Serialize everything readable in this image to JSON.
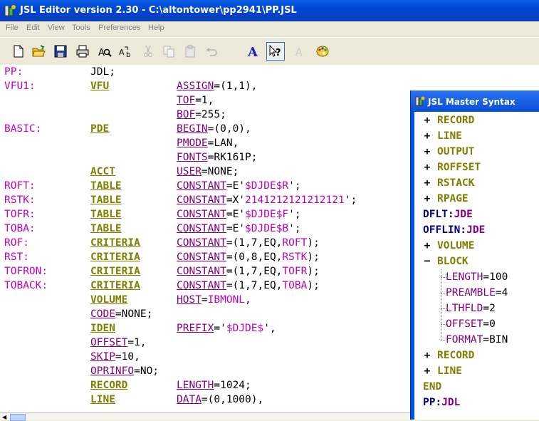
{
  "window": {
    "title": "JSL Editor version 2.30 - C:\\altontower\\pp2941\\PP.JSL"
  },
  "menu": [
    "File",
    "Edit",
    "View",
    "Tools",
    "Preferences",
    "Help"
  ],
  "toolbar": [
    "new-icon",
    "open-icon",
    "save-icon",
    "print-icon",
    "find-icon",
    "replace-icon",
    "cut-icon",
    "copy-icon",
    "paste-icon",
    "undo-icon",
    "font-icon",
    "context-help-icon",
    "font-disabled-icon",
    "palette-icon"
  ],
  "editor": {
    "lines": [
      {
        "c1": "PP:",
        "c2": "JDL;",
        "c2kw": false,
        "c3": []
      },
      {
        "c1": "VFU1:",
        "c2": "VFU",
        "c2kw": true,
        "c3": [
          {
            "t": "ASSIGN",
            "k": "op"
          },
          {
            "t": "=(1,1),",
            "k": "pl"
          }
        ]
      },
      {
        "c1": "",
        "c2": "",
        "c3": [
          {
            "t": "TOF",
            "k": "op"
          },
          {
            "t": "=1,",
            "k": "pl"
          }
        ]
      },
      {
        "c1": "",
        "c2": "",
        "c3": [
          {
            "t": "BOF",
            "k": "op"
          },
          {
            "t": "=255;",
            "k": "pl"
          }
        ]
      },
      {
        "c1": "BASIC:",
        "c2": "PDE",
        "c2kw": true,
        "c3": [
          {
            "t": "BEGIN",
            "k": "op"
          },
          {
            "t": "=(0,0),",
            "k": "pl"
          }
        ]
      },
      {
        "c1": "",
        "c2": "",
        "c3": [
          {
            "t": "PMODE",
            "k": "op"
          },
          {
            "t": "=LAN,",
            "k": "pl"
          }
        ]
      },
      {
        "c1": "",
        "c2": "",
        "c3": [
          {
            "t": "FONTS",
            "k": "op"
          },
          {
            "t": "=RK161P;",
            "k": "pl"
          }
        ]
      },
      {
        "c1": "",
        "c2": "ACCT",
        "c2kw": true,
        "c3": [
          {
            "t": "USER",
            "k": "op"
          },
          {
            "t": "=NONE;",
            "k": "pl"
          }
        ]
      },
      {
        "c1": "ROFT:",
        "c2": "TABLE",
        "c2kw": true,
        "c3": [
          {
            "t": "CONSTANT",
            "k": "op"
          },
          {
            "t": "=E'",
            "k": "pl"
          },
          {
            "t": "$DJDE$R",
            "k": "mg"
          },
          {
            "t": "';",
            "k": "pl"
          }
        ]
      },
      {
        "c1": "RSTK:",
        "c2": "TABLE",
        "c2kw": true,
        "c3": [
          {
            "t": "CONSTANT",
            "k": "op"
          },
          {
            "t": "=X'",
            "k": "pl"
          },
          {
            "t": "2141212121212121",
            "k": "mg"
          },
          {
            "t": "';",
            "k": "pl"
          }
        ]
      },
      {
        "c1": "TOFR:",
        "c2": "TABLE",
        "c2kw": true,
        "c3": [
          {
            "t": "CONSTANT",
            "k": "op"
          },
          {
            "t": "=E'",
            "k": "pl"
          },
          {
            "t": "$DJDE$F",
            "k": "mg"
          },
          {
            "t": "';",
            "k": "pl"
          }
        ]
      },
      {
        "c1": "TOBA:",
        "c2": "TABLE",
        "c2kw": true,
        "c3": [
          {
            "t": "CONSTANT",
            "k": "op"
          },
          {
            "t": "=E'",
            "k": "pl"
          },
          {
            "t": "$DJDE$B",
            "k": "mg"
          },
          {
            "t": "';",
            "k": "pl"
          }
        ]
      },
      {
        "c1": "ROF:",
        "c2": "CRITERIA",
        "c2kw": true,
        "c3": [
          {
            "t": "CONSTANT",
            "k": "op"
          },
          {
            "t": "=(1,7,EQ,",
            "k": "pl"
          },
          {
            "t": "ROFT",
            "k": "mg"
          },
          {
            "t": ");",
            "k": "pl"
          }
        ]
      },
      {
        "c1": "RST:",
        "c2": "CRITERIA",
        "c2kw": true,
        "c3": [
          {
            "t": "CONSTANT",
            "k": "op"
          },
          {
            "t": "=(0,8,EQ,",
            "k": "pl"
          },
          {
            "t": "RSTK",
            "k": "mg"
          },
          {
            "t": ");",
            "k": "pl"
          }
        ]
      },
      {
        "c1": "TOFRON:",
        "c2": "CRITERIA",
        "c2kw": true,
        "c3": [
          {
            "t": "CONSTANT",
            "k": "op"
          },
          {
            "t": "=(1,7,EQ,",
            "k": "pl"
          },
          {
            "t": "TOFR",
            "k": "mg"
          },
          {
            "t": ");",
            "k": "pl"
          }
        ]
      },
      {
        "c1": "TOBACK:",
        "c2": "CRITERIA",
        "c2kw": true,
        "c3": [
          {
            "t": "CONSTANT",
            "k": "op"
          },
          {
            "t": "=(1,7,EQ,",
            "k": "pl"
          },
          {
            "t": "TOBA",
            "k": "mg"
          },
          {
            "t": ");",
            "k": "pl"
          }
        ]
      },
      {
        "c1": "",
        "c2": "VOLUME",
        "c2kw": true,
        "c3": [
          {
            "t": "HOST",
            "k": "op"
          },
          {
            "t": "=",
            "k": "pl"
          },
          {
            "t": "IBMONL",
            "k": "mg"
          },
          {
            "t": ",",
            "k": "pl"
          }
        ]
      },
      {
        "c1": "",
        "c2": "",
        "c2line": [
          {
            "t": "CODE",
            "k": "op"
          },
          {
            "t": "=NONE;",
            "k": "pl"
          }
        ],
        "c3": []
      },
      {
        "c1": "",
        "c2": "IDEN",
        "c2kw": true,
        "c3": [
          {
            "t": "PREFIX",
            "k": "op"
          },
          {
            "t": "='",
            "k": "pl"
          },
          {
            "t": "$DJDE$",
            "k": "mg"
          },
          {
            "t": "',",
            "k": "pl"
          }
        ]
      },
      {
        "c1": "",
        "c2": "",
        "c2line": [
          {
            "t": "OFFSET",
            "k": "op"
          },
          {
            "t": "=1,",
            "k": "pl"
          }
        ],
        "c3": []
      },
      {
        "c1": "",
        "c2": "",
        "c2line": [
          {
            "t": "SKIP",
            "k": "op"
          },
          {
            "t": "=10,",
            "k": "pl"
          }
        ],
        "c3": []
      },
      {
        "c1": "",
        "c2": "",
        "c2line": [
          {
            "t": "OPRINFO",
            "k": "op"
          },
          {
            "t": "=NO;",
            "k": "pl"
          }
        ],
        "c3": []
      },
      {
        "c1": "",
        "c2": "RECORD",
        "c2kw": true,
        "c3": [
          {
            "t": "LENGTH",
            "k": "op"
          },
          {
            "t": "=1024;",
            "k": "pl"
          }
        ]
      },
      {
        "c1": "",
        "c2": "LINE",
        "c2kw": true,
        "c3": [
          {
            "t": "DATA",
            "k": "op"
          },
          {
            "t": "=(0,1000),",
            "k": "pl"
          }
        ]
      }
    ]
  },
  "master_syntax": {
    "title": "JSL Master Syntax",
    "nodes": [
      {
        "pm": "+",
        "label": "RECORD",
        "kind": "kw"
      },
      {
        "pm": "+",
        "label": "LINE",
        "kind": "kw"
      },
      {
        "pm": "+",
        "label": "OUTPUT",
        "kind": "kw"
      },
      {
        "pm": "+",
        "label": "ROFFSET",
        "kind": "kw"
      },
      {
        "pm": "+",
        "label": "RSTACK",
        "kind": "kw"
      },
      {
        "pm": "+",
        "label": "RPAGE",
        "kind": "kw"
      },
      {
        "pm": "",
        "label": "DFLT",
        "sep": ":",
        "val": "JDE",
        "kind": "blue"
      },
      {
        "pm": "",
        "label": "OFFLIN",
        "sep": ":",
        "val": "JDE",
        "kind": "blue"
      },
      {
        "pm": "+",
        "label": "VOLUME",
        "kind": "kw"
      },
      {
        "pm": "−",
        "label": "BLOCK",
        "kind": "kw"
      },
      {
        "pm": "",
        "label": "LENGTH",
        "sep": "=",
        "val": "100",
        "kind": "leaf"
      },
      {
        "pm": "",
        "label": "PREAMBLE",
        "sep": "=",
        "val": "4",
        "kind": "leaf"
      },
      {
        "pm": "",
        "label": "LTHFLD",
        "sep": "=",
        "val": "2",
        "kind": "leaf"
      },
      {
        "pm": "",
        "label": "OFFSET",
        "sep": "=",
        "val": "0",
        "kind": "leaf"
      },
      {
        "pm": "",
        "label": "FORMAT",
        "sep": "=",
        "val": "BIN",
        "kind": "leaf"
      },
      {
        "pm": "+",
        "label": "RECORD",
        "kind": "kw"
      },
      {
        "pm": "+",
        "label": "LINE",
        "kind": "kw"
      },
      {
        "pm": "",
        "label": "END",
        "kind": "kw"
      },
      {
        "pm": "",
        "label": "PP",
        "sep": ":",
        "val": "JDL",
        "kind": "blue"
      }
    ]
  },
  "colors": {
    "label": "#c000c0",
    "keyword": "#808000",
    "operand": "#800080",
    "titlebar": "#0054e3"
  }
}
